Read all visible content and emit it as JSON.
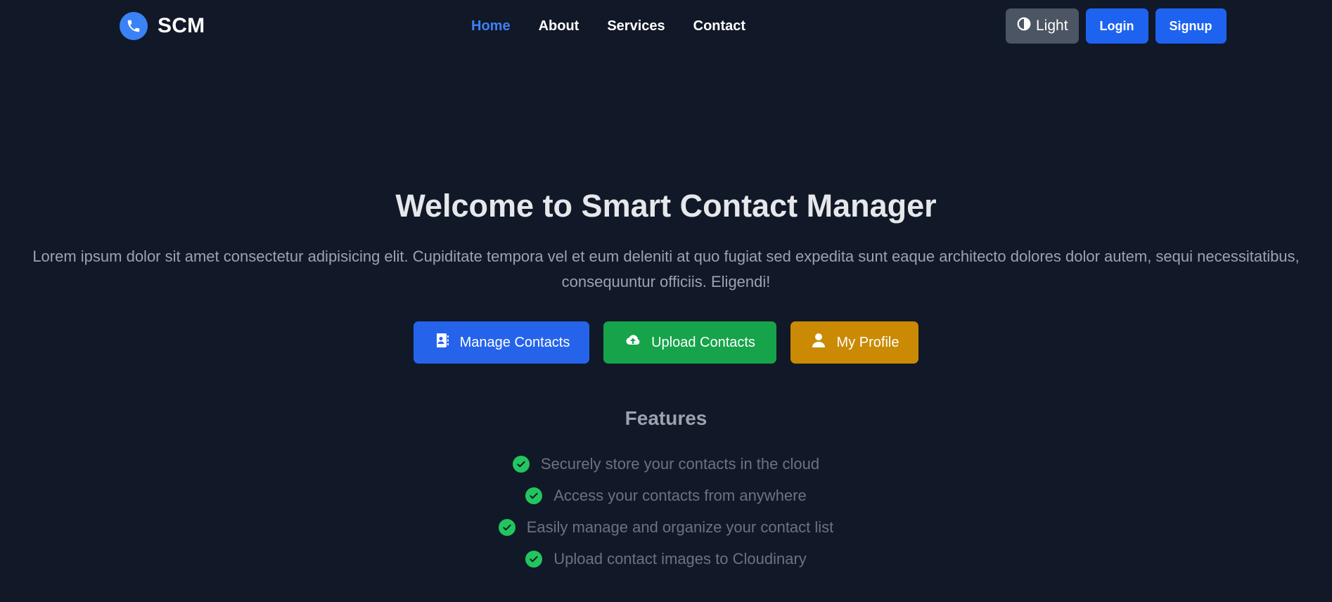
{
  "navbar": {
    "brand": "SCM",
    "links": [
      {
        "label": "Home",
        "active": true
      },
      {
        "label": "About",
        "active": false
      },
      {
        "label": "Services",
        "active": false
      },
      {
        "label": "Contact",
        "active": false
      }
    ],
    "theme_toggle_label": "Light",
    "login_label": "Login",
    "signup_label": "Signup"
  },
  "hero": {
    "title": "Welcome to Smart Contact Manager",
    "description": "Lorem ipsum dolor sit amet consectetur adipisicing elit. Cupiditate tempora vel et eum deleniti at quo fugiat sed expedita sunt eaque architecto dolores dolor autem, sequi necessitatibus, consequuntur officiis. Eligendi!",
    "buttons": [
      {
        "label": "Manage Contacts",
        "icon": "address-book-icon",
        "color": "#2563eb"
      },
      {
        "label": "Upload Contacts",
        "icon": "cloud-upload-icon",
        "color": "#16a34a"
      },
      {
        "label": "My Profile",
        "icon": "user-icon",
        "color": "#ca8a04"
      }
    ]
  },
  "features": {
    "title": "Features",
    "items": [
      "Securely store your contacts in the cloud",
      "Access your contacts from anywhere",
      "Easily manage and organize your contact list",
      "Upload contact images to Cloudinary"
    ]
  },
  "colors": {
    "background": "#111827",
    "accent": "#3b82f6",
    "check": "#22c55e"
  }
}
